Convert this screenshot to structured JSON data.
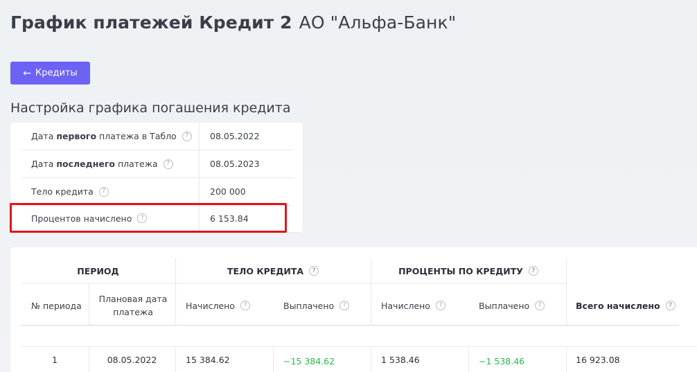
{
  "header": {
    "title": "График платежей Кредит 2",
    "bank": "АО \"Альфа-Банк\""
  },
  "back_button": {
    "arrow": "←",
    "label": "Кредиты"
  },
  "section_title": "Настройка графика погашения кредита",
  "settings": {
    "rows": [
      {
        "pre": "Дата ",
        "bold": "первого",
        "post": " платежа в Табло",
        "value": "08.05.2022"
      },
      {
        "pre": "Дата ",
        "bold": "последнего",
        "post": " платежа",
        "value": "08.05.2023"
      },
      {
        "pre": "Тело кредита",
        "bold": "",
        "post": "",
        "value": "200 000"
      },
      {
        "pre": "Процентов начислено",
        "bold": "",
        "post": "",
        "value": "6 153.84"
      }
    ]
  },
  "help_glyph": "?",
  "schedule": {
    "group_headers": {
      "period": "ПЕРИОД",
      "body": "ТЕЛО КРЕДИТА",
      "interest": "ПРОЦЕНТЫ ПО КРЕДИТУ"
    },
    "columns": {
      "period_no": "№ периода",
      "planned_date": "Плановая дата платежа",
      "body_accrued": "Начислено",
      "body_paid": "Выплачено",
      "interest_accrued": "Начислено",
      "interest_paid": "Выплачено",
      "total_accrued": "Всего начислено"
    },
    "rows": [
      {
        "period_no": "1",
        "planned_date": "08.05.2022",
        "body_accrued": "15 384.62",
        "body_paid": "−15 384.62",
        "interest_accrued": "1 538.46",
        "interest_paid": "−1 538.46",
        "total_accrued": "16 923.08"
      }
    ]
  },
  "colors": {
    "accent": "#6c63f5",
    "highlight": "#e3131b",
    "paid": "#2bb84a"
  }
}
